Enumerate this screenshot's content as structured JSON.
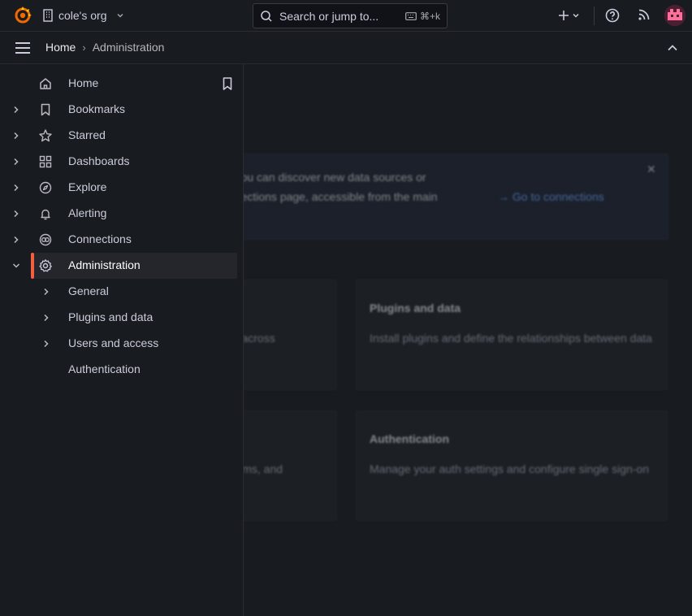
{
  "topbar": {
    "org_name": "cole's org",
    "search_placeholder": "Search or jump to...",
    "search_shortcut": "⌘+k"
  },
  "breadcrumb": {
    "home": "Home",
    "separator": "›",
    "current": "Administration"
  },
  "sidebar": {
    "items": [
      {
        "label": "Home"
      },
      {
        "label": "Bookmarks"
      },
      {
        "label": "Starred"
      },
      {
        "label": "Dashboards"
      },
      {
        "label": "Explore"
      },
      {
        "label": "Alerting"
      },
      {
        "label": "Connections"
      },
      {
        "label": "Administration",
        "active": true
      },
      {
        "label": "General"
      },
      {
        "label": "Plugins and data"
      },
      {
        "label": "Users and access"
      },
      {
        "label": "Authentication"
      }
    ]
  },
  "background": {
    "banner_line1": "! You can discover new data sources or",
    "banner_line2": "nnections page, accessible from the main",
    "banner_link": "Go to connections",
    "cards": [
      {
        "desc": "ngs across"
      },
      {
        "title": "Plugins and data",
        "desc": "Install plugins and define the relationships between data"
      },
      {
        "desc": ", teams, and"
      },
      {
        "title": "Authentication",
        "desc": "Manage your auth settings and configure single sign-on"
      }
    ]
  },
  "colors": {
    "accent": "#f55f3e",
    "link": "#6e9fff",
    "bg": "#181b1f"
  }
}
